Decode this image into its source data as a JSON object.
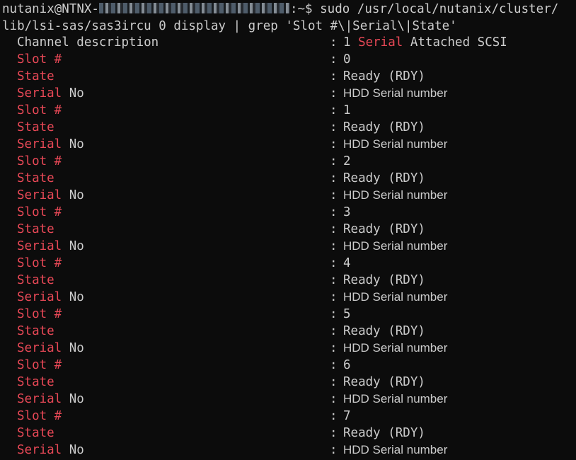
{
  "command": {
    "user_host": "nutanix@NTNX-",
    "prompt_suffix": ":~$ ",
    "line1_rest": "sudo /usr/local/nutanix/cluster/",
    "line2": "lib/lsi-sas/sas3ircu 0 display | grep 'Slot #\\|Serial\\|State'"
  },
  "channel": {
    "label": "Channel description",
    "sep": ":",
    "value_pre": "1 ",
    "value_hl": "Serial",
    "value_post": " Attached SCSI"
  },
  "labels": {
    "slot": "Slot #",
    "state": "State",
    "serial_hl": "Serial",
    "serial_rest": " No",
    "sep": ":"
  },
  "slots": [
    {
      "slot": "0",
      "state": "Ready (RDY)",
      "serial": "HDD Serial number"
    },
    {
      "slot": "1",
      "state": "Ready (RDY)",
      "serial": "HDD Serial number"
    },
    {
      "slot": "2",
      "state": "Ready (RDY)",
      "serial": "HDD Serial number"
    },
    {
      "slot": "3",
      "state": "Ready (RDY)",
      "serial": "HDD Serial number"
    },
    {
      "slot": "4",
      "state": "Ready (RDY)",
      "serial": "HDD Serial number"
    },
    {
      "slot": "5",
      "state": "Ready (RDY)",
      "serial": "HDD Serial number"
    },
    {
      "slot": "6",
      "state": "Ready (RDY)",
      "serial": "HDD Serial number"
    },
    {
      "slot": "7",
      "state": "Ready (RDY)",
      "serial": "HDD Serial number"
    }
  ],
  "colors": {
    "background": "#0c0c0c",
    "text": "#cccccc",
    "highlight": "#e74856"
  }
}
